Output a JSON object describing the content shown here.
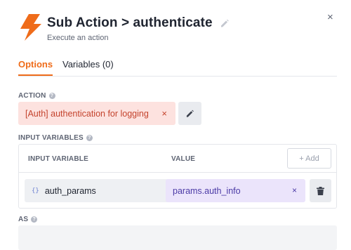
{
  "header": {
    "title": "Sub Action > authenticate",
    "subtitle": "Execute an action",
    "icon": "lightning-bolt-icon",
    "accent_color": "#ef6c1a",
    "close_label": "×"
  },
  "tabs": [
    {
      "label": "Options",
      "active": true
    },
    {
      "label": "Variables (0)",
      "active": false
    }
  ],
  "action": {
    "label": "ACTION",
    "value": "[Auth] authentication for logging",
    "remove_label": "×"
  },
  "input_variables": {
    "label": "INPUT VARIABLES",
    "columns": [
      "INPUT VARIABLE",
      "VALUE"
    ],
    "add_label": "+ Add",
    "rows": [
      {
        "variable": "auth_params",
        "type_icon": "{}",
        "value": "params.auth_info",
        "remove_label": "×"
      }
    ]
  },
  "as_field": {
    "label": "AS",
    "value": ""
  }
}
